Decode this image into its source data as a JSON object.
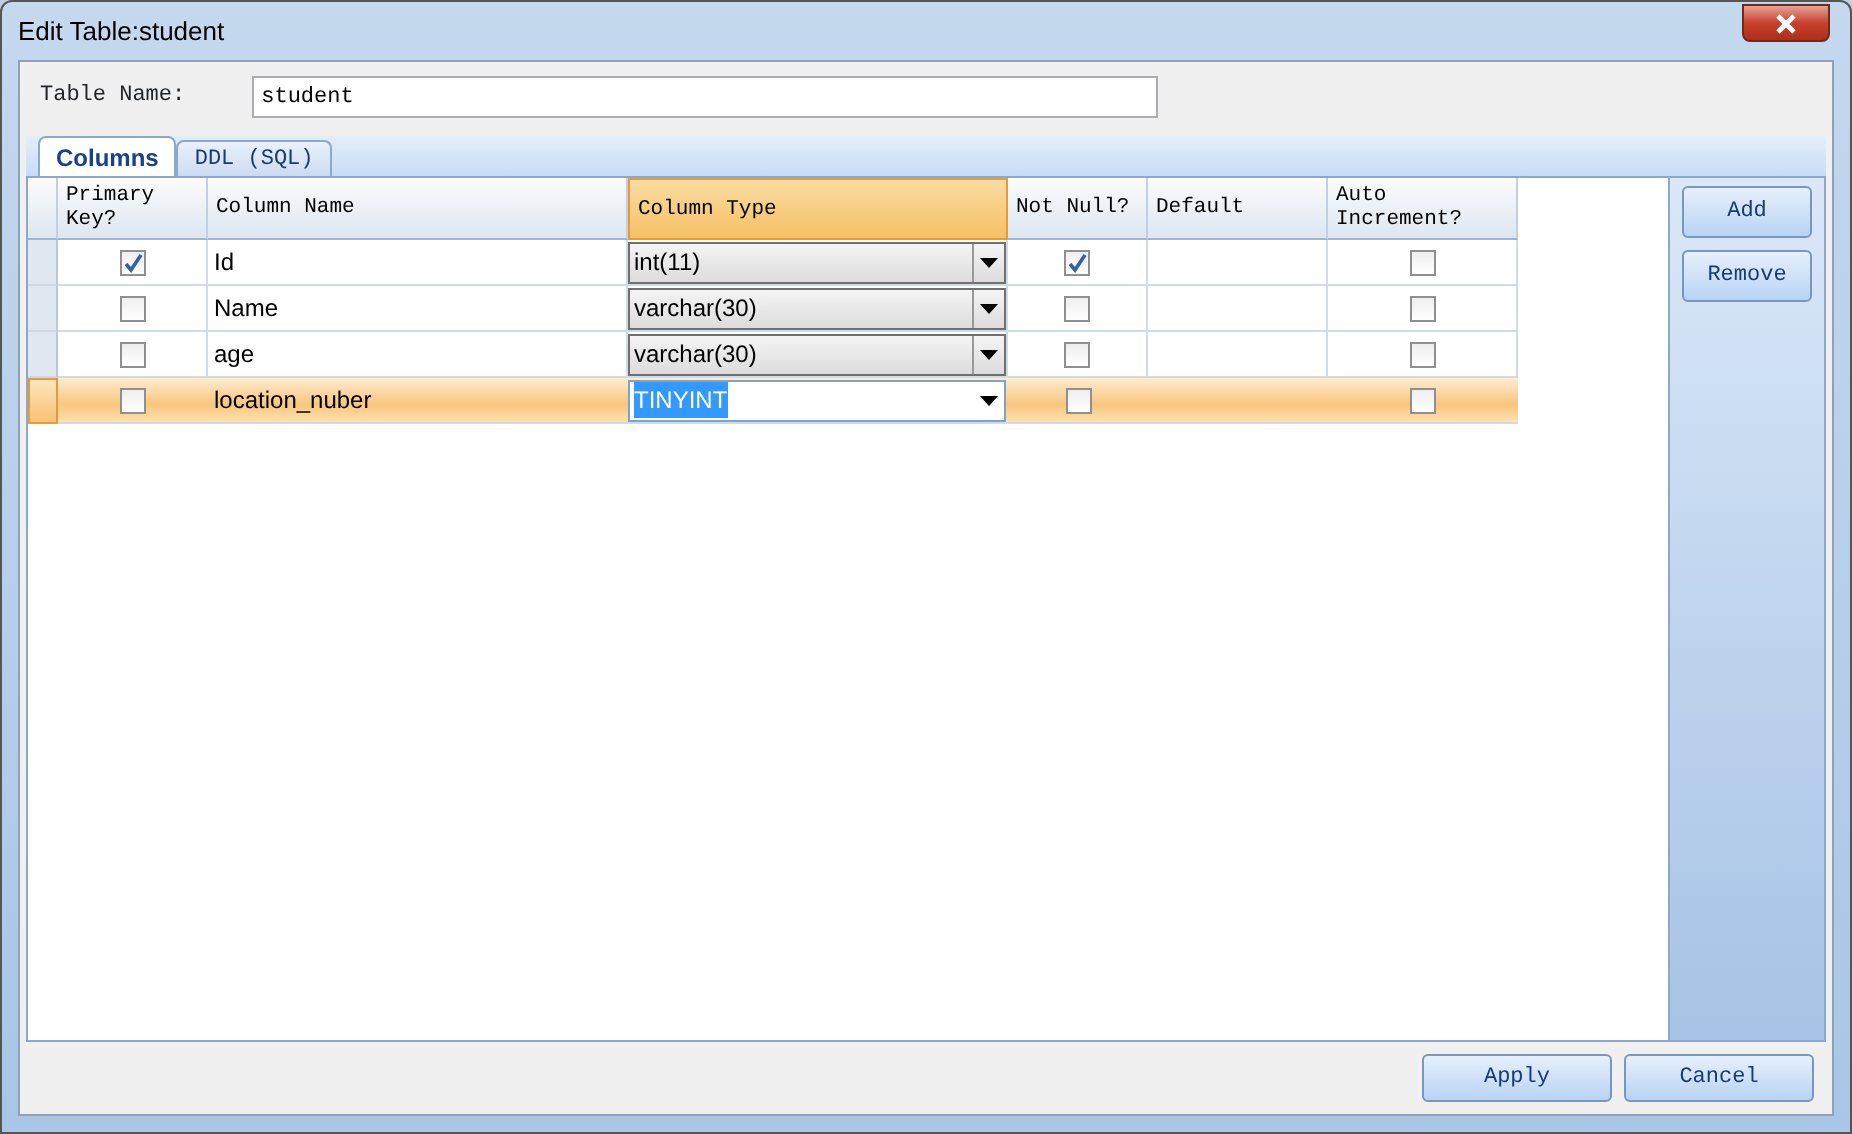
{
  "window": {
    "title": "Edit Table:student"
  },
  "table_name": {
    "label": "Table Name:",
    "value": "student"
  },
  "tabs": [
    {
      "label": "Columns",
      "selected": true
    },
    {
      "label": "DDL (SQL)",
      "selected": false
    }
  ],
  "grid": {
    "columns": [
      {
        "label": "Primary Key?",
        "selected": false
      },
      {
        "label": "Column Name",
        "selected": false
      },
      {
        "label": "Column Type",
        "selected": true
      },
      {
        "label": "Not Null?",
        "selected": false
      },
      {
        "label": "Default",
        "selected": false
      },
      {
        "label": "Auto Increment?",
        "selected": false
      }
    ],
    "rows": [
      {
        "name": "Id",
        "type": "int(11)",
        "primary_key": true,
        "not_null": true,
        "auto_increment": false,
        "selected": false
      },
      {
        "name": "Name",
        "type": "varchar(30)",
        "primary_key": false,
        "not_null": false,
        "auto_increment": false,
        "selected": false
      },
      {
        "name": "age",
        "type": "varchar(30)",
        "primary_key": false,
        "not_null": false,
        "auto_increment": false,
        "selected": false
      },
      {
        "name": "location_nuber",
        "type": "TINYINT",
        "primary_key": false,
        "not_null": false,
        "auto_increment": false,
        "selected": true
      }
    ]
  },
  "side_buttons": [
    "Add",
    "Remove"
  ],
  "footer_buttons": [
    "Apply",
    "Cancel"
  ]
}
